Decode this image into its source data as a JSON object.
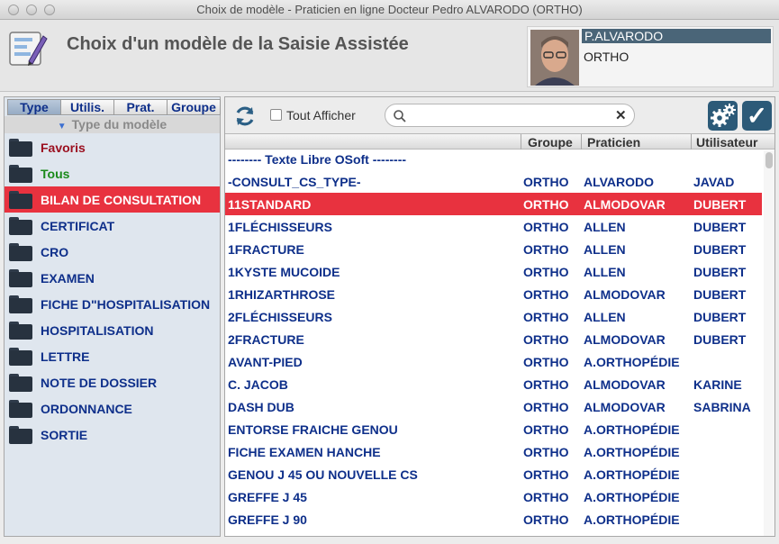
{
  "window": {
    "title": "Choix de modèle - Praticien en ligne Docteur Pedro ALVARODO (ORTHO)"
  },
  "header": {
    "title": "Choix d'un modèle de la Saisie Assistée"
  },
  "user": {
    "name": "P.ALVARODO",
    "specialty": "ORTHO"
  },
  "tabs": [
    "Type",
    "Utilis.",
    "Prat.",
    "Groupe"
  ],
  "type_header": "Type du modèle",
  "types": [
    {
      "label": "Favoris",
      "color": "#9b1020"
    },
    {
      "label": "Tous",
      "color": "#1a8a1a"
    },
    {
      "label": "BILAN DE CONSULTATION",
      "selected": true
    },
    {
      "label": "CERTIFICAT"
    },
    {
      "label": "CRO"
    },
    {
      "label": "EXAMEN"
    },
    {
      "label": "FICHE D\"HOSPITALISATION"
    },
    {
      "label": "HOSPITALISATION"
    },
    {
      "label": "LETTRE"
    },
    {
      "label": "NOTE DE DOSSIER"
    },
    {
      "label": "ORDONNANCE"
    },
    {
      "label": "SORTIE"
    }
  ],
  "toolbar": {
    "show_all_label": "Tout Afficher",
    "search_value": "",
    "search_placeholder": ""
  },
  "columns": {
    "group": "Groupe",
    "praticien": "Praticien",
    "user": "Utilisateur"
  },
  "separator_row": "-------- Texte Libre OSoft --------",
  "rows": [
    {
      "name": "-CONSULT_CS_TYPE-",
      "group": "ORTHO",
      "praticien": "ALVARODO",
      "user": "JAVAD"
    },
    {
      "name": "11STANDARD",
      "group": "ORTHO",
      "praticien": "ALMODOVAR",
      "user": "DUBERT",
      "selected": true
    },
    {
      "name": "1FLÉCHISSEURS",
      "group": "ORTHO",
      "praticien": "ALLEN",
      "user": "DUBERT"
    },
    {
      "name": "1FRACTURE",
      "group": "ORTHO",
      "praticien": "ALLEN",
      "user": "DUBERT"
    },
    {
      "name": "1KYSTE MUCOIDE",
      "group": "ORTHO",
      "praticien": "ALLEN",
      "user": "DUBERT"
    },
    {
      "name": "1RHIZARTHROSE",
      "group": "ORTHO",
      "praticien": "ALMODOVAR",
      "user": "DUBERT"
    },
    {
      "name": "2FLÉCHISSEURS",
      "group": "ORTHO",
      "praticien": "ALLEN",
      "user": "DUBERT"
    },
    {
      "name": "2FRACTURE",
      "group": "ORTHO",
      "praticien": "ALMODOVAR",
      "user": "DUBERT"
    },
    {
      "name": "AVANT-PIED",
      "group": "ORTHO",
      "praticien": "A.ORTHOPÉDIE",
      "user": ""
    },
    {
      "name": "C. JACOB",
      "group": "ORTHO",
      "praticien": "ALMODOVAR",
      "user": "KARINE"
    },
    {
      "name": "DASH  DUB",
      "group": "ORTHO",
      "praticien": "ALMODOVAR",
      "user": "SABRINA"
    },
    {
      "name": "ENTORSE FRAICHE GENOU",
      "group": "ORTHO",
      "praticien": "A.ORTHOPÉDIE",
      "user": ""
    },
    {
      "name": "FICHE EXAMEN HANCHE",
      "group": "ORTHO",
      "praticien": "A.ORTHOPÉDIE",
      "user": ""
    },
    {
      "name": "GENOU J 45 OU NOUVELLE CS",
      "group": "ORTHO",
      "praticien": "A.ORTHOPÉDIE",
      "user": ""
    },
    {
      "name": "GREFFE J 45",
      "group": "ORTHO",
      "praticien": "A.ORTHOPÉDIE",
      "user": ""
    },
    {
      "name": "GREFFE J 90",
      "group": "ORTHO",
      "praticien": "A.ORTHOPÉDIE",
      "user": ""
    }
  ]
}
